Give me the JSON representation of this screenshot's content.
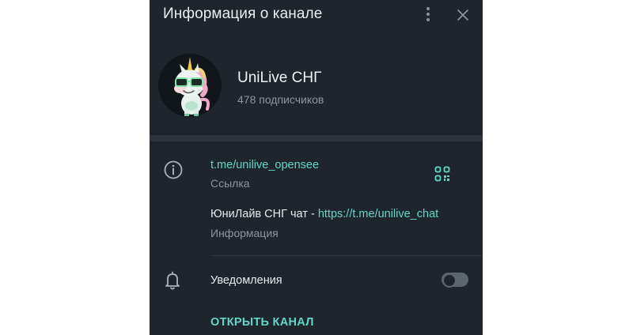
{
  "header": {
    "title": "Информация о канале",
    "menu_icon": "kebab-menu-icon",
    "close_icon": "close-icon"
  },
  "channel": {
    "name": "UniLive СНГ",
    "subscribers": "478 подписчиков",
    "avatar": "unicorn-with-sunglasses-avatar"
  },
  "info": {
    "link": "t.me/unilive_opensee",
    "link_caption": "Ссылка",
    "description_text": "ЮниЛайв СНГ чат - ",
    "description_link": "https://t.me/unilive_chat",
    "description_caption": "Информация"
  },
  "notifications": {
    "label": "Уведомления",
    "enabled": false
  },
  "actions": {
    "open_channel": "ОТКРЫТЬ КАНАЛ"
  },
  "colors": {
    "panel_bg": "#1f252c",
    "accent": "#5ed8c8",
    "secondary_text": "#8b959e"
  }
}
